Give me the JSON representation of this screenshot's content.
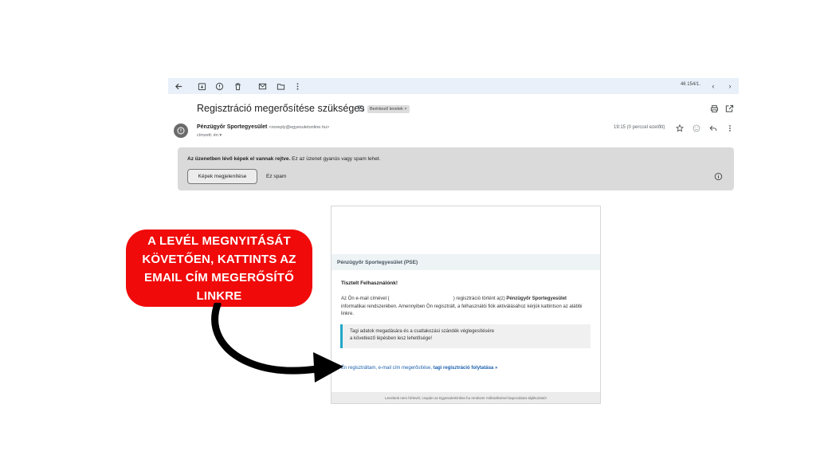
{
  "toolbar": {
    "count": "46 154/1.",
    "icons": [
      "back-arrow-icon",
      "archive-icon",
      "report-spam-icon",
      "delete-icon",
      "mark-unread-icon",
      "move-to-icon",
      "more-vert-icon",
      "prev-icon",
      "next-icon"
    ]
  },
  "email": {
    "subject": "Regisztráció megerősítése szükséges",
    "label": "Beérkező levelek ×",
    "sender_name": "Pénzügyőr Sportegyesület",
    "sender_email": "<noreply@egyesuletonline.hu>",
    "recipient": "címzett: én ▾",
    "time": "19:15 (0 perccel ezelőtt)"
  },
  "warning": {
    "bold_text": "Az üzenetben lévő képek el vannak rejtve.",
    "text": " Ez az üzenet gyanús vagy spam lehet.",
    "show_images_label": "Képek megjelenítése",
    "spam_label": "Ez spam"
  },
  "card": {
    "header": "Pénzügyőr Sportegyesület (PSE)",
    "greeting": "Tisztelt Felhasználónk!",
    "body_prefix": "Az Ön e-mail címével (",
    "body_mid": ") regisztráció történt a(z) ",
    "body_org": "Pénzügyőr Sportegyesület",
    "body_suffix": " informatikai rendszerében. Amennyiben Ön regisztrált, a felhasználói fiók aktiválásához kérjük kattintson az alábbi linkre.",
    "note_line1": "Tagi adatok megadására és a csatlakozási szándék véglegesítésére",
    "note_line2": "a következő lépésben lesz lehetősége!",
    "link_text": "Én regisztráltam, e-mail cím megerősítése, ",
    "link_bold": "tagi regisztráció folytatása »",
    "footer": "Levelünk nem hírlevél, csupán az EgyesuletOnline.hu rendszer működésével kapcsolatos tájékoztató!"
  },
  "callout": {
    "text": "A LEVÉL MEGNYITÁSÁT KÖVETŐEN, KATTINTS AZ EMAIL CÍM MEGERŐSÍTŐ LINKRE"
  },
  "colors": {
    "callout_red": "#f00a0a",
    "toolbar_bg": "#e9f0fa",
    "note_accent": "#21a7c9",
    "link_blue": "#1a5fae"
  }
}
